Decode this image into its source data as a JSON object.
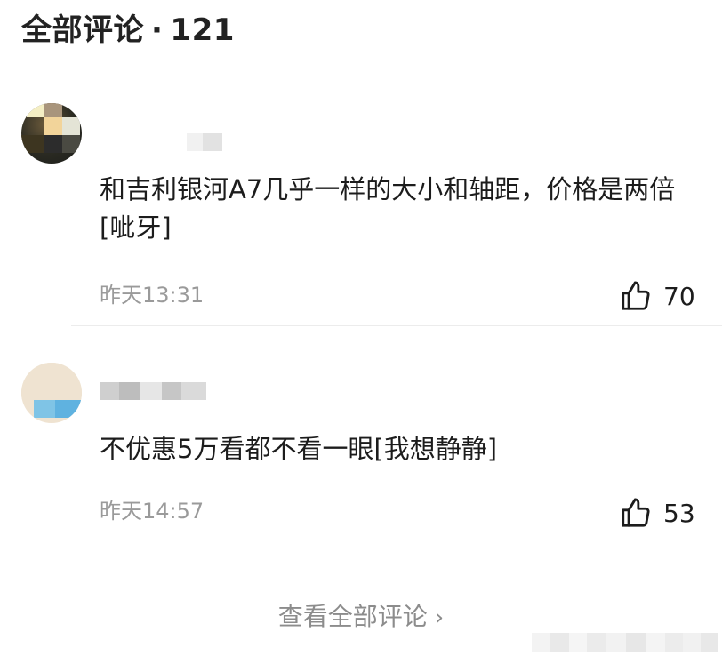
{
  "header": {
    "title": "全部评论",
    "separator": "·",
    "count": "121"
  },
  "comments": [
    {
      "text": "和吉利银河A7几乎一样的大小和轴距，价格是两倍[呲牙]",
      "time": "昨天13:31",
      "likes": "70",
      "like_icon": "thumbs-up-icon"
    },
    {
      "text": "不优惠5万看都不看一眼[我想静静]",
      "time": "昨天14:57",
      "likes": "53",
      "like_icon": "thumbs-up-icon"
    }
  ],
  "footer": {
    "view_all": "查看全部评论",
    "chevron": "›"
  },
  "colors": {
    "time_gray": "#9a9a9a",
    "link_gray": "#8c8c8c",
    "text": "#1c1c1c"
  }
}
